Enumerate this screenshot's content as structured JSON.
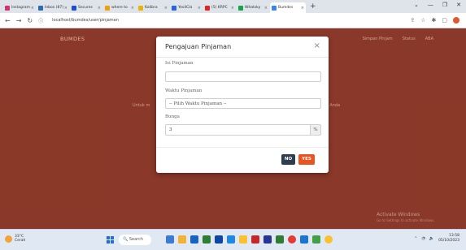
{
  "browser": {
    "tabs": [
      {
        "label": "Instagram",
        "color": "#d6336c"
      },
      {
        "label": "Inbox (87)",
        "color": "#2b6cb0"
      },
      {
        "label": "Secures",
        "color": "#1d4ed8"
      },
      {
        "label": "where to",
        "color": "#f59e0b"
      },
      {
        "label": "Kalibra",
        "color": "#eab308"
      },
      {
        "label": "Yes4Cla",
        "color": "#2563eb"
      },
      {
        "label": "(5) KRPC",
        "color": "#dc2626"
      },
      {
        "label": "Whatsky",
        "color": "#16a34a"
      },
      {
        "label": "Bumdes",
        "color": "#3b82f6"
      }
    ],
    "url": "localhost/bumdes/user/pinjaman"
  },
  "app": {
    "brand": "BUMDES",
    "nav": [
      "Simpan Pinjam",
      "Status",
      "ABA"
    ],
    "bg_left": "Untuk m",
    "bg_right": "s Anda",
    "watermark_title": "Activate Windows",
    "watermark_sub": "Go to Settings to activate Windows."
  },
  "modal": {
    "title": "Pengajuan Pinjaman",
    "close": "×",
    "fields": {
      "amount_label": "Isi Pinjaman",
      "term_label": "Waktu Pinjaman",
      "term_selected": "-- Pilih Waktu Pinjaman --",
      "interest_label": "Bunga",
      "interest_value": "3",
      "interest_suffix": "%"
    },
    "btn_no": "NO",
    "btn_yes": "YES"
  },
  "taskbar": {
    "weather_temp": "33°C",
    "weather_desc": "Cerah",
    "search": "Search",
    "time": "13:58",
    "date": "05/10/2023"
  }
}
